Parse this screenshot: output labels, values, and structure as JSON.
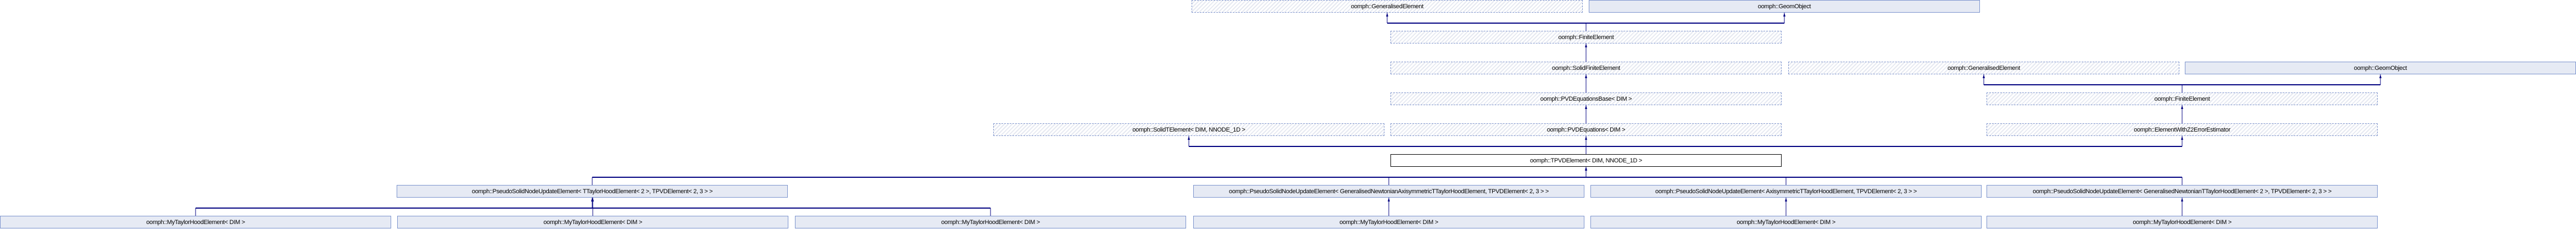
{
  "diagram": {
    "edge_color": "#000080",
    "nodes": [
      {
        "id": "n0",
        "label": "oomph::GeneralisedElement",
        "style": "undoc"
      },
      {
        "id": "n1",
        "label": "oomph::GeomObject",
        "style": "doc"
      },
      {
        "id": "n2",
        "label": "oomph::FiniteElement",
        "style": "undoc"
      },
      {
        "id": "n3",
        "label": "oomph::SolidFiniteElement",
        "style": "undoc"
      },
      {
        "id": "n4",
        "label": "oomph::GeneralisedElement",
        "style": "undoc"
      },
      {
        "id": "n5",
        "label": "oomph::GeomObject",
        "style": "doc"
      },
      {
        "id": "n6",
        "label": "oomph::PVDEquationsBase< DIM >",
        "style": "undoc"
      },
      {
        "id": "n7",
        "label": "oomph::FiniteElement",
        "style": "undoc"
      },
      {
        "id": "n8",
        "label": "oomph::SolidTElement< DIM, NNODE_1D >",
        "style": "undoc"
      },
      {
        "id": "n9",
        "label": "oomph::PVDEquations< DIM >",
        "style": "undoc"
      },
      {
        "id": "n10",
        "label": "oomph::ElementWithZ2ErrorEstimator",
        "style": "undoc"
      },
      {
        "id": "n11",
        "label": "oomph::TPVDElement< DIM, NNODE_1D >",
        "style": "current"
      },
      {
        "id": "n12",
        "label": "oomph::PseudoSolidNodeUpdateElement< TTaylorHoodElement< 2 >, TPVDElement< 2, 3 > >",
        "style": "doc"
      },
      {
        "id": "n13",
        "label": "oomph::PseudoSolidNodeUpdateElement< GeneralisedNewtonianAxisymmetricTTaylorHoodElement, TPVDElement< 2, 3 > >",
        "style": "doc"
      },
      {
        "id": "n14",
        "label": "oomph::PseudoSolidNodeUpdateElement< AxisymmetricTTaylorHoodElement, TPVDElement< 2, 3 > >",
        "style": "doc"
      },
      {
        "id": "n15",
        "label": "oomph::PseudoSolidNodeUpdateElement< GeneralisedNewtonianTTaylorHoodElement< 2 >, TPVDElement< 2, 3 > >",
        "style": "doc"
      },
      {
        "id": "n16",
        "label": "oomph::MyTaylorHoodElement< DIM >",
        "style": "doc"
      },
      {
        "id": "n17",
        "label": "oomph::MyTaylorHoodElement< DIM >",
        "style": "doc"
      },
      {
        "id": "n18",
        "label": "oomph::MyTaylorHoodElement< DIM >",
        "style": "doc"
      },
      {
        "id": "n19",
        "label": "oomph::MyTaylorHoodElement< DIM >",
        "style": "doc"
      },
      {
        "id": "n20",
        "label": "oomph::MyTaylorHoodElement< DIM >",
        "style": "doc"
      },
      {
        "id": "n21",
        "label": "oomph::MyTaylorHoodElement< DIM >",
        "style": "doc"
      }
    ],
    "inheritance": [
      {
        "child": "n2",
        "parents": [
          "n0",
          "n1"
        ]
      },
      {
        "child": "n3",
        "parents": [
          "n2"
        ]
      },
      {
        "child": "n6",
        "parents": [
          "n3"
        ]
      },
      {
        "child": "n7",
        "parents": [
          "n4",
          "n5"
        ]
      },
      {
        "child": "n9",
        "parents": [
          "n6"
        ]
      },
      {
        "child": "n10",
        "parents": [
          "n7"
        ]
      },
      {
        "child": "n11",
        "parents": [
          "n8",
          "n9",
          "n10"
        ]
      },
      {
        "child": "n12",
        "parents": [
          "n11"
        ]
      },
      {
        "child": "n13",
        "parents": [
          "n11"
        ]
      },
      {
        "child": "n14",
        "parents": [
          "n11"
        ]
      },
      {
        "child": "n15",
        "parents": [
          "n11"
        ]
      },
      {
        "child": "n16",
        "parents": [
          "n12"
        ]
      },
      {
        "child": "n17",
        "parents": [
          "n12"
        ]
      },
      {
        "child": "n18",
        "parents": [
          "n12"
        ]
      },
      {
        "child": "n19",
        "parents": [
          "n13"
        ]
      },
      {
        "child": "n20",
        "parents": [
          "n14"
        ]
      },
      {
        "child": "n21",
        "parents": [
          "n15"
        ]
      }
    ]
  }
}
